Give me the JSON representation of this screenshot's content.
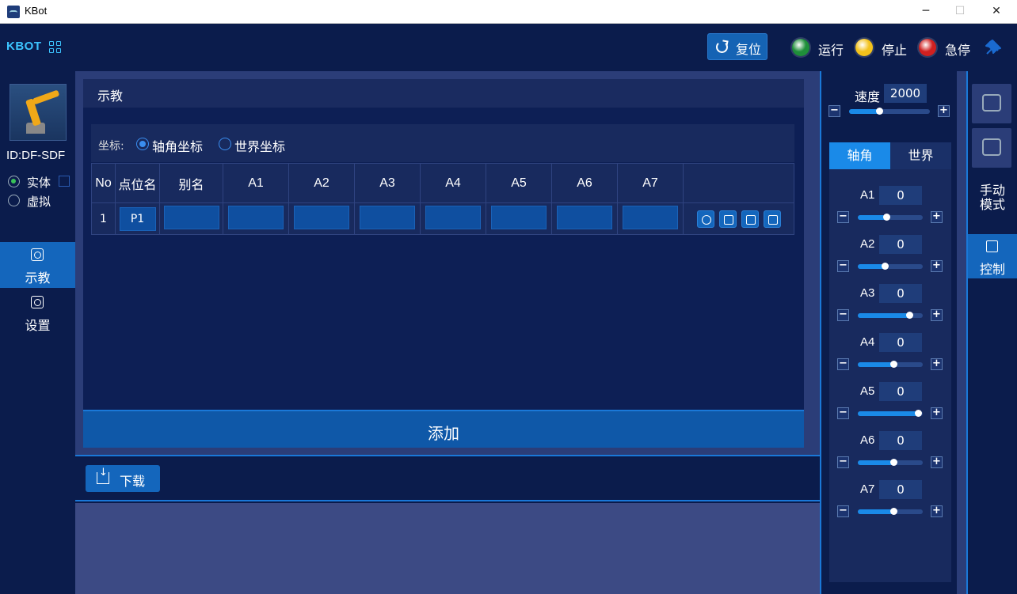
{
  "window": {
    "title": "KBot",
    "minimize": "─",
    "maximize": "☐",
    "close": "✕"
  },
  "header": {
    "brand": "KBOT",
    "reset_label": "复位",
    "statuses": [
      {
        "label": "运行",
        "color": "#1f8f3a"
      },
      {
        "label": "停止",
        "color": "#f3c21c"
      },
      {
        "label": "急停",
        "color": "#d02020"
      }
    ]
  },
  "sidebar": {
    "robot_id": "ID:DF-SDF",
    "modes": [
      {
        "label": "实体",
        "active": true
      },
      {
        "label": "虚拟",
        "active": false
      }
    ],
    "nav": [
      {
        "label": "示教",
        "active": true
      },
      {
        "label": "设置",
        "active": false
      }
    ]
  },
  "teach": {
    "title": "示教",
    "coord_label": "坐标:",
    "coord_options": [
      {
        "label": "轴角坐标",
        "selected": true
      },
      {
        "label": "世界坐标",
        "selected": false
      }
    ],
    "columns": [
      "No",
      "点位名",
      "别名",
      "A1",
      "A2",
      "A3",
      "A4",
      "A5",
      "A6",
      "A7",
      ""
    ],
    "rows": [
      {
        "no": "1",
        "name": "P1",
        "alias": "",
        "a1": "",
        "a2": "",
        "a3": "",
        "a4": "",
        "a5": "",
        "a6": "",
        "a7": ""
      }
    ],
    "actions": [
      "locate-icon",
      "brush-icon",
      "trash-icon",
      "copy-icon"
    ],
    "add_label": "添加"
  },
  "download": {
    "label": "下载"
  },
  "control": {
    "speed_label": "速度",
    "speed_value": "2000",
    "speed_fraction": 0.37,
    "tabs": [
      {
        "label": "轴角",
        "active": true
      },
      {
        "label": "世界",
        "active": false
      }
    ],
    "joints": [
      {
        "name": "A1",
        "value": "0",
        "fraction": 0.44
      },
      {
        "name": "A2",
        "value": "0",
        "fraction": 0.41
      },
      {
        "name": "A3",
        "value": "0",
        "fraction": 0.79
      },
      {
        "name": "A4",
        "value": "0",
        "fraction": 0.55
      },
      {
        "name": "A5",
        "value": "0",
        "fraction": 0.93
      },
      {
        "name": "A6",
        "value": "0",
        "fraction": 0.55
      },
      {
        "name": "A7",
        "value": "0",
        "fraction": 0.55
      }
    ]
  },
  "right_strip": {
    "mode_label_line1": "手动",
    "mode_label_line2": "模式",
    "control_label": "控制"
  },
  "colors": {
    "accent": "#1a8ae8",
    "panel": "#0d1f55",
    "brand": "#3cc4ff"
  }
}
